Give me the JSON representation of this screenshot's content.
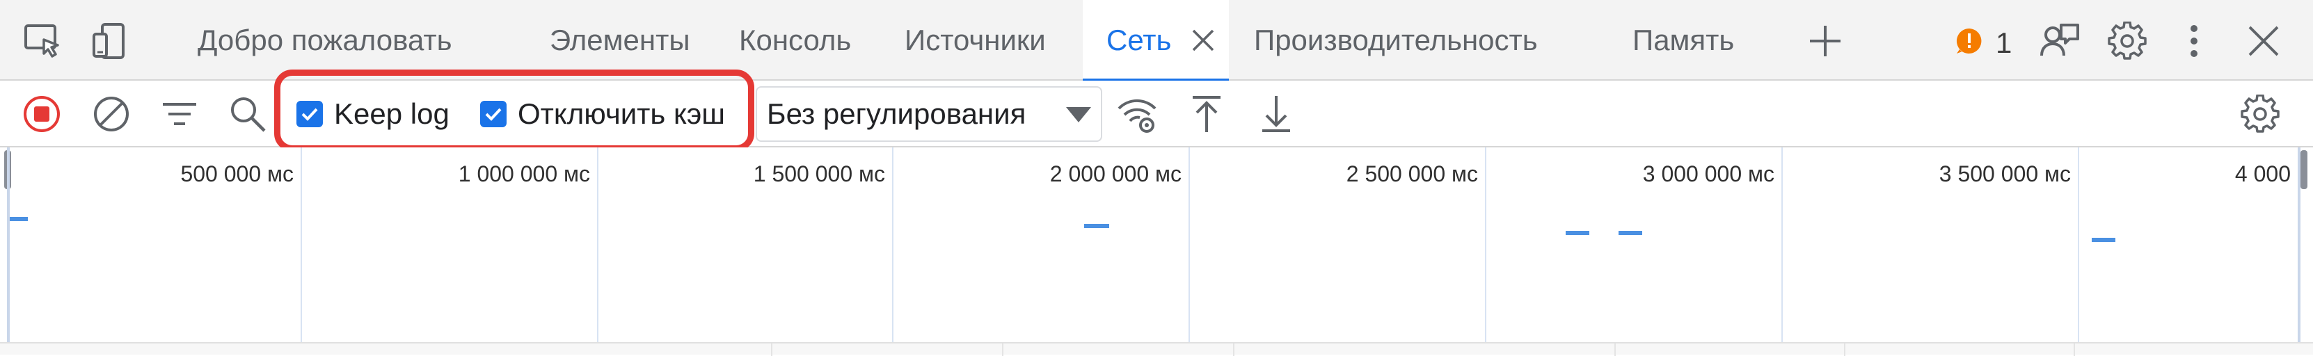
{
  "tabs": [
    {
      "label": "Добро пожаловать",
      "active": false
    },
    {
      "label": "Элементы",
      "active": false
    },
    {
      "label": "Консоль",
      "active": false
    },
    {
      "label": "Источники",
      "active": false
    },
    {
      "label": "Сеть",
      "active": true
    },
    {
      "label": "Производительность",
      "active": false
    },
    {
      "label": "Память",
      "active": false
    }
  ],
  "tabbar": {
    "issues_count": "1"
  },
  "toolbar": {
    "keep_log_label": "Keep log",
    "keep_log_checked": true,
    "disable_cache_label": "Отключить кэш",
    "disable_cache_checked": true,
    "throttle_value": "Без регулирования"
  },
  "overview": {
    "ticks": [
      "500 000 мс",
      "1 000 000 мс",
      "1 500 000 мс",
      "2 000 000 мс",
      "2 500 000 мс",
      "3 000 000 мс",
      "3 500 000 мс",
      "4 000"
    ]
  },
  "colors": {
    "accent": "#1a73e8",
    "highlight": "#e53935",
    "record": "#e53935",
    "warning": "#f57c00",
    "timeline_bar": "#4a90e2"
  }
}
